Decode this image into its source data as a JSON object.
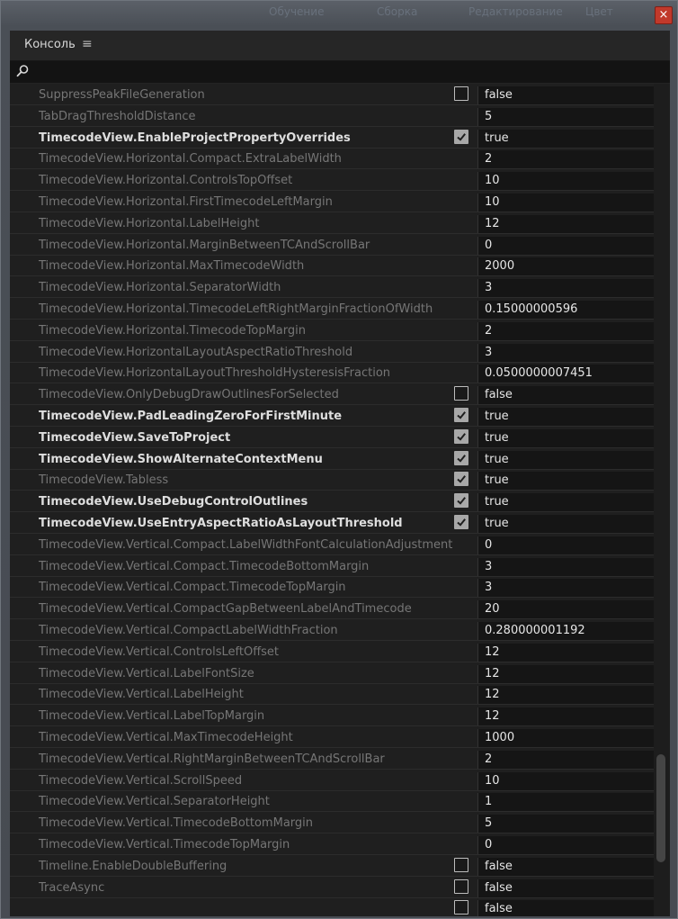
{
  "window": {
    "close_label": "×",
    "ghost_tabs": [
      "Обучение",
      "Сборка",
      "Редактирование",
      "Цвет"
    ]
  },
  "panel": {
    "title": "Консоль",
    "menu_icon": "≡",
    "search": {
      "value": "",
      "placeholder": ""
    }
  },
  "rows": [
    {
      "name": "SuppressPeakFileGeneration",
      "bold": false,
      "checkbox": true,
      "checked": false,
      "value": "false"
    },
    {
      "name": "TabDragThresholdDistance",
      "bold": false,
      "checkbox": false,
      "value": "5"
    },
    {
      "name": "TimecodeView.EnableProjectPropertyOverrides",
      "bold": true,
      "checkbox": true,
      "checked": true,
      "value": "true"
    },
    {
      "name": "TimecodeView.Horizontal.Compact.ExtraLabelWidth",
      "bold": false,
      "checkbox": false,
      "value": "2"
    },
    {
      "name": "TimecodeView.Horizontal.ControlsTopOffset",
      "bold": false,
      "checkbox": false,
      "value": "10"
    },
    {
      "name": "TimecodeView.Horizontal.FirstTimecodeLeftMargin",
      "bold": false,
      "checkbox": false,
      "value": "10"
    },
    {
      "name": "TimecodeView.Horizontal.LabelHeight",
      "bold": false,
      "checkbox": false,
      "value": "12"
    },
    {
      "name": "TimecodeView.Horizontal.MarginBetweenTCAndScrollBar",
      "bold": false,
      "checkbox": false,
      "value": "0"
    },
    {
      "name": "TimecodeView.Horizontal.MaxTimecodeWidth",
      "bold": false,
      "checkbox": false,
      "value": "2000"
    },
    {
      "name": "TimecodeView.Horizontal.SeparatorWidth",
      "bold": false,
      "checkbox": false,
      "value": "3"
    },
    {
      "name": "TimecodeView.Horizontal.TimecodeLeftRightMarginFractionOfWidth",
      "bold": false,
      "checkbox": false,
      "value": "0.15000000596"
    },
    {
      "name": "TimecodeView.Horizontal.TimecodeTopMargin",
      "bold": false,
      "checkbox": false,
      "value": "2"
    },
    {
      "name": "TimecodeView.HorizontalLayoutAspectRatioThreshold",
      "bold": false,
      "checkbox": false,
      "value": "3"
    },
    {
      "name": "TimecodeView.HorizontalLayoutThresholdHysteresisFraction",
      "bold": false,
      "checkbox": false,
      "value": "0.0500000007451"
    },
    {
      "name": "TimecodeView.OnlyDebugDrawOutlinesForSelected",
      "bold": false,
      "checkbox": true,
      "checked": false,
      "value": "false"
    },
    {
      "name": "TimecodeView.PadLeadingZeroForFirstMinute",
      "bold": true,
      "checkbox": true,
      "checked": true,
      "value": "true"
    },
    {
      "name": "TimecodeView.SaveToProject",
      "bold": true,
      "checkbox": true,
      "checked": true,
      "value": "true"
    },
    {
      "name": "TimecodeView.ShowAlternateContextMenu",
      "bold": true,
      "checkbox": true,
      "checked": true,
      "value": "true"
    },
    {
      "name": "TimecodeView.Tabless",
      "bold": false,
      "checkbox": true,
      "checked": true,
      "value": "true"
    },
    {
      "name": "TimecodeView.UseDebugControlOutlines",
      "bold": true,
      "checkbox": true,
      "checked": true,
      "value": "true"
    },
    {
      "name": "TimecodeView.UseEntryAspectRatioAsLayoutThreshold",
      "bold": true,
      "checkbox": true,
      "checked": true,
      "value": "true"
    },
    {
      "name": "TimecodeView.Vertical.Compact.LabelWidthFontCalculationAdjustment",
      "bold": false,
      "checkbox": false,
      "value": "0"
    },
    {
      "name": "TimecodeView.Vertical.Compact.TimecodeBottomMargin",
      "bold": false,
      "checkbox": false,
      "value": "3"
    },
    {
      "name": "TimecodeView.Vertical.Compact.TimecodeTopMargin",
      "bold": false,
      "checkbox": false,
      "value": "3"
    },
    {
      "name": "TimecodeView.Vertical.CompactGapBetweenLabelAndTimecode",
      "bold": false,
      "checkbox": false,
      "value": "20"
    },
    {
      "name": "TimecodeView.Vertical.CompactLabelWidthFraction",
      "bold": false,
      "checkbox": false,
      "value": "0.280000001192"
    },
    {
      "name": "TimecodeView.Vertical.ControlsLeftOffset",
      "bold": false,
      "checkbox": false,
      "value": "12"
    },
    {
      "name": "TimecodeView.Vertical.LabelFontSize",
      "bold": false,
      "checkbox": false,
      "value": "12"
    },
    {
      "name": "TimecodeView.Vertical.LabelHeight",
      "bold": false,
      "checkbox": false,
      "value": "12"
    },
    {
      "name": "TimecodeView.Vertical.LabelTopMargin",
      "bold": false,
      "checkbox": false,
      "value": "12"
    },
    {
      "name": "TimecodeView.Vertical.MaxTimecodeHeight",
      "bold": false,
      "checkbox": false,
      "value": "1000"
    },
    {
      "name": "TimecodeView.Vertical.RightMarginBetweenTCAndScrollBar",
      "bold": false,
      "checkbox": false,
      "value": "2"
    },
    {
      "name": "TimecodeView.Vertical.ScrollSpeed",
      "bold": false,
      "checkbox": false,
      "value": "10"
    },
    {
      "name": "TimecodeView.Vertical.SeparatorHeight",
      "bold": false,
      "checkbox": false,
      "value": "1"
    },
    {
      "name": "TimecodeView.Vertical.TimecodeBottomMargin",
      "bold": false,
      "checkbox": false,
      "value": "5"
    },
    {
      "name": "TimecodeView.Vertical.TimecodeTopMargin",
      "bold": false,
      "checkbox": false,
      "value": "0"
    },
    {
      "name": "Timeline.EnableDoubleBuffering",
      "bold": false,
      "checkbox": true,
      "checked": false,
      "value": "false"
    },
    {
      "name": "TraceAsync",
      "bold": false,
      "checkbox": true,
      "checked": false,
      "value": "false"
    },
    {
      "name": "",
      "bold": false,
      "checkbox": true,
      "checked": false,
      "value": "false"
    }
  ],
  "colors": {
    "panel_bg": "#232323",
    "name_dim": "#767676",
    "name_bold": "#dedede",
    "value_text": "#e6e6e6",
    "close_red": "#c1392b"
  }
}
